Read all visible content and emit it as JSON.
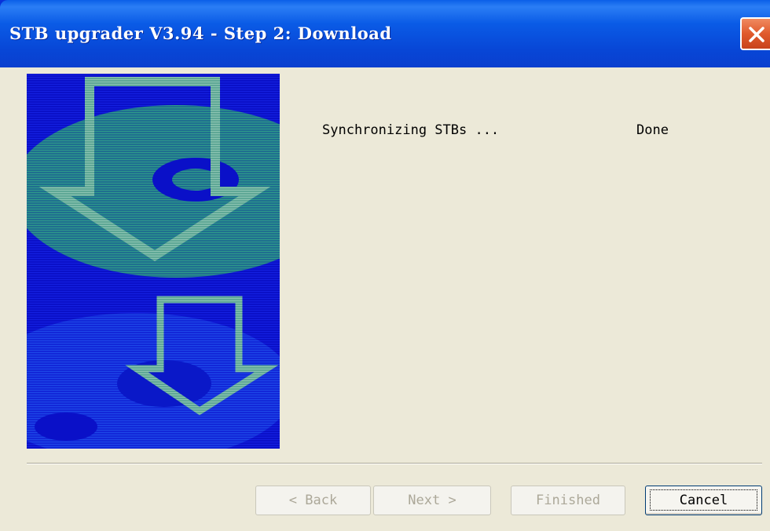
{
  "window": {
    "title": "STB upgrader V3.94 - Step 2: Download"
  },
  "status": {
    "label": "Synchronizing STBs ...",
    "value": "Done"
  },
  "buttons": {
    "back": "< Back",
    "next": "Next >",
    "finished": "Finished",
    "cancel": "Cancel"
  },
  "icons": {
    "close": "close-icon",
    "side_graphic": "download-arrow-illustration"
  },
  "colors": {
    "titlebar": "#0a5be6",
    "close_button": "#e05a2c",
    "dialog_background": "#ece9d8",
    "illustration_blue": "#0a10c8",
    "illustration_teal": "#2a8f8a",
    "arrow_fill": "#5fa896"
  }
}
